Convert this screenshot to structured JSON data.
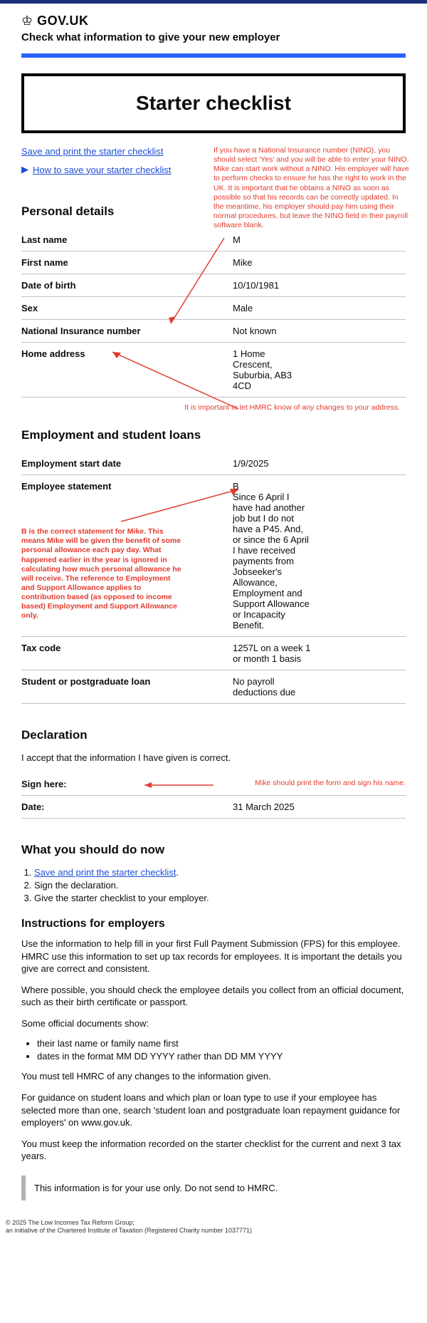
{
  "header": {
    "site": "GOV.UK",
    "tool_title": "Check what information to give your new employer"
  },
  "checklist_title": "Starter checklist",
  "links": {
    "save_print": "Save and print the starter checklist",
    "how_to_save": "How to save your starter checklist"
  },
  "annotations": {
    "nino": "If you have a National Insurance number (NINO), you should select 'Yes' and you will be able to enter your NINO. Mike can start work without a NINO. His employer will have to perform checks to ensure he has the right to work in the UK. It is important that he obtains a NINO as soon as possible so that his records can be correctly updated. In the meantime, his employer should pay him using their normal procedures, but leave the NINO field in their payroll software blank.",
    "address": "It is important to let HMRC know of any changes to your address.",
    "statement_b": "B is the correct statement for Mike. This means Mike will be given the benefit of some personal allowance each pay day. What happened earlier in the year is ignored in calculating how much personal allowance he will receive. The reference to Employment and Support Allowance applies to contribution based (as opposed to income based) Employment and Support Allowance only.",
    "sign": "Mike should print the form and sign his name."
  },
  "personal": {
    "heading": "Personal details",
    "rows": {
      "last_name": {
        "label": "Last name",
        "value": "M"
      },
      "first_name": {
        "label": "First name",
        "value": "Mike"
      },
      "dob": {
        "label": "Date of birth",
        "value": "10/10/1981"
      },
      "sex": {
        "label": "Sex",
        "value": "Male"
      },
      "nino": {
        "label": "National Insurance number",
        "value": "Not known"
      },
      "address": {
        "label": "Home address",
        "value": "1 Home Crescent, Suburbia, AB3 4CD"
      }
    }
  },
  "employment": {
    "heading": "Employment and student loans",
    "rows": {
      "start": {
        "label": "Employment start date",
        "value": "1/9/2025"
      },
      "statement": {
        "label": "Employee statement",
        "value": "B\nSince 6 April I have had another job but I do not have a P45. And, or since the 6 April I have received payments from Jobseeker's Allowance, Employment and Support Allowance or Incapacity Benefit."
      },
      "taxcode": {
        "label": "Tax code",
        "value": "1257L on a week 1 or month 1 basis"
      },
      "loan": {
        "label": "Student or postgraduate loan",
        "value": "No payroll deductions due"
      }
    }
  },
  "declaration": {
    "heading": "Declaration",
    "intro": "I accept that the information I have given is correct.",
    "sign_label": "Sign here:",
    "date_label": "Date:",
    "date_value": "31 March 2025"
  },
  "next": {
    "heading": "What you should do now",
    "steps": [
      "Save and print the starter checklist",
      "Sign the declaration.",
      "Give the starter checklist to your employer."
    ]
  },
  "employers": {
    "heading": "Instructions for employers",
    "p1": "Use the information to help fill in your first Full Payment Submission (FPS) for this employee.\nHMRC use this information to set up tax records for employees. It is important the details you give are correct and consistent.",
    "p2": "Where possible, you should check the employee details you collect from an official document, such as their birth certificate or passport.",
    "p3": "Some official documents show:",
    "bullets": [
      "their last name or family name first",
      "dates in the format MM DD YYYY rather than DD MM YYYY"
    ],
    "p4": "You must tell HMRC of any changes to the information given.",
    "p5": "For guidance on student loans and which plan or loan type to use if your employee has selected more than one, search 'student loan and postgraduate loan repayment guidance for employers' on www.gov.uk.",
    "p6": "You must keep the information recorded on the starter checklist for the current and next 3 tax years.",
    "notice": "This information is for your use only. Do not send to HMRC."
  },
  "footer": {
    "line1": "© 2025 The Low Incomes Tax Reform Group;",
    "line2": "an initiative of the Chartered Institute of Taxation (Registered Charity number 1037771)"
  }
}
